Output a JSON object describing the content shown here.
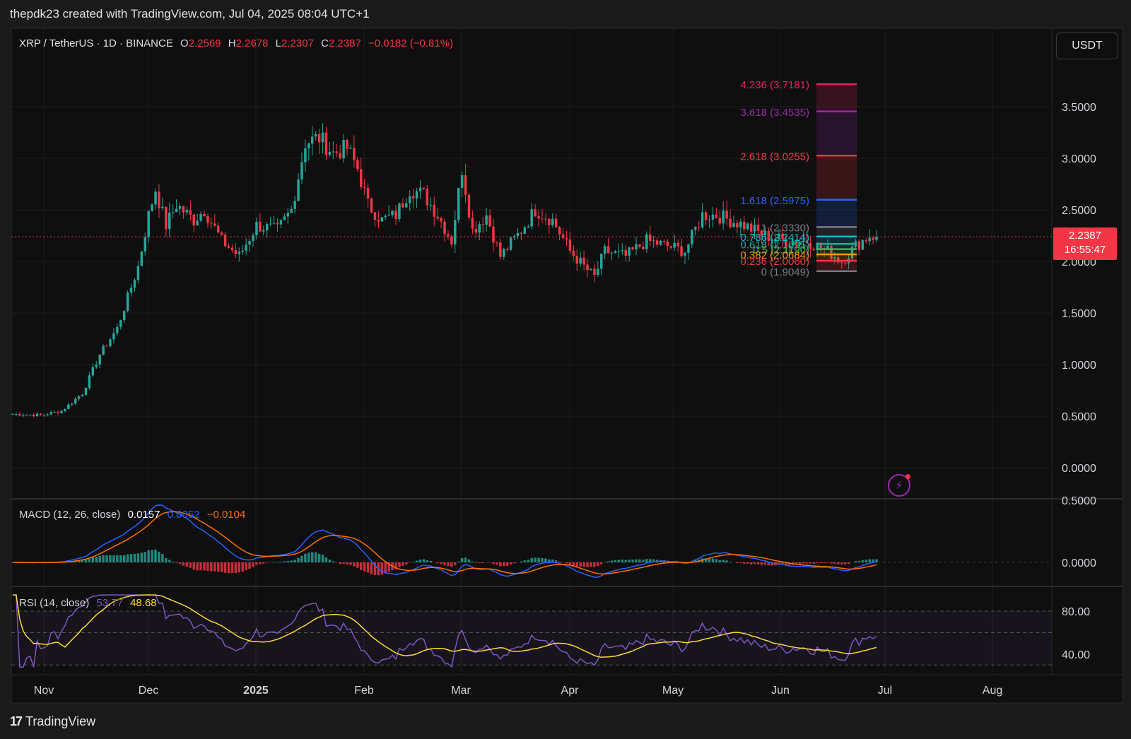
{
  "header": {
    "text": "thepdk23 created with TradingView.com, Jul 04, 2025 08:04 UTC+1"
  },
  "symbol": {
    "pair": "XRP / TetherUS · 1D · BINANCE",
    "o_label": "O",
    "o": "2.2569",
    "h_label": "H",
    "h": "2.2678",
    "l_label": "L",
    "l": "2.2307",
    "c_label": "C",
    "c": "2.2387",
    "change": "−0.0182 (−0.81%)"
  },
  "currency_button": "USDT",
  "last_price": {
    "value": "2.2387",
    "countdown": "16:55:47"
  },
  "colors": {
    "up": "#26a69a",
    "down": "#f23645",
    "bg": "#0f0f0f",
    "macd": "#2962ff",
    "signal": "#ff6d00",
    "rsi": "#7e57c2",
    "rsi_ma": "#fdd835"
  },
  "x_axis": {
    "labels": [
      "Nov",
      "Dec",
      "2025",
      "Feb",
      "Mar",
      "Apr",
      "May",
      "Jun",
      "Jul",
      "Aug"
    ]
  },
  "fib_levels": [
    {
      "label": "4.236 (3.7181)",
      "value": 3.7181,
      "color": "#e91e63"
    },
    {
      "label": "3.618 (3.4535)",
      "value": 3.4535,
      "color": "#9c27b0"
    },
    {
      "label": "2.618 (3.0255)",
      "value": 3.0255,
      "color": "#f23645"
    },
    {
      "label": "1.618 (2.5975)",
      "value": 2.5975,
      "color": "#2962ff"
    },
    {
      "label": "1 (2.3330)",
      "value": 2.333,
      "color": "#787b86"
    },
    {
      "label": "0.786 (2.2414)",
      "value": 2.2414,
      "color": "#00bcd4"
    },
    {
      "label": "0.618 (2.1695)",
      "value": 2.1695,
      "color": "#26a69a"
    },
    {
      "label": "0.5 (2.1190)",
      "value": 2.119,
      "color": "#4caf50"
    },
    {
      "label": "0.382 (2.0684)",
      "value": 2.0684,
      "color": "#ff9800"
    },
    {
      "label": "0.236 (2.0060)",
      "value": 2.006,
      "color": "#f23645"
    },
    {
      "label": "0 (1.9049)",
      "value": 1.9049,
      "color": "#787b86"
    }
  ],
  "macd": {
    "title": "MACD (12, 26, close)",
    "hist": "0.0157",
    "macd": "0.0052",
    "signal": "−0.0104",
    "axis_labels": [
      "0.5000",
      "0.0000"
    ]
  },
  "rsi": {
    "title": "RSI (14, close)",
    "value": "53.77",
    "ma": "48.68",
    "axis_labels": [
      "80.00",
      "40.00"
    ]
  },
  "brand": {
    "name": "TradingView"
  },
  "chart_data": {
    "type": "candlestick",
    "title": "XRP / TetherUS · 1D · BINANCE",
    "y_axis_labels": [
      "3.5000",
      "3.0000",
      "2.5000",
      "2.0000",
      "1.5000",
      "1.0000",
      "0.5000",
      "0.0000"
    ],
    "ylim": [
      -0.1,
      3.9
    ],
    "x_labels": [
      "Nov",
      "Dec",
      "2025",
      "Feb",
      "Mar",
      "Apr",
      "May",
      "Jun",
      "Jul",
      "Aug"
    ],
    "close_anchors": [
      {
        "day": 0,
        "v": 0.52
      },
      {
        "day": 8,
        "v": 0.51
      },
      {
        "day": 14,
        "v": 0.55
      },
      {
        "day": 20,
        "v": 0.72
      },
      {
        "day": 25,
        "v": 1.1
      },
      {
        "day": 30,
        "v": 1.35
      },
      {
        "day": 33,
        "v": 1.65
      },
      {
        "day": 36,
        "v": 1.95
      },
      {
        "day": 39,
        "v": 2.45
      },
      {
        "day": 41,
        "v": 2.7
      },
      {
        "day": 44,
        "v": 2.35
      },
      {
        "day": 47,
        "v": 2.55
      },
      {
        "day": 52,
        "v": 2.4
      },
      {
        "day": 55,
        "v": 2.5
      },
      {
        "day": 60,
        "v": 2.2
      },
      {
        "day": 65,
        "v": 2.05
      },
      {
        "day": 70,
        "v": 2.35
      },
      {
        "day": 76,
        "v": 2.3
      },
      {
        "day": 80,
        "v": 2.5
      },
      {
        "day": 84,
        "v": 3.15
      },
      {
        "day": 88,
        "v": 3.2
      },
      {
        "day": 92,
        "v": 3.05
      },
      {
        "day": 96,
        "v": 3.1
      },
      {
        "day": 99,
        "v": 2.9
      },
      {
        "day": 102,
        "v": 2.55
      },
      {
        "day": 106,
        "v": 2.4
      },
      {
        "day": 110,
        "v": 2.45
      },
      {
        "day": 114,
        "v": 2.7
      },
      {
        "day": 118,
        "v": 2.65
      },
      {
        "day": 122,
        "v": 2.45
      },
      {
        "day": 126,
        "v": 2.2
      },
      {
        "day": 129,
        "v": 2.9
      },
      {
        "day": 132,
        "v": 2.3
      },
      {
        "day": 136,
        "v": 2.45
      },
      {
        "day": 140,
        "v": 2.05
      },
      {
        "day": 146,
        "v": 2.3
      },
      {
        "day": 150,
        "v": 2.5
      },
      {
        "day": 155,
        "v": 2.4
      },
      {
        "day": 160,
        "v": 2.1
      },
      {
        "day": 164,
        "v": 1.95
      },
      {
        "day": 167,
        "v": 1.85
      },
      {
        "day": 170,
        "v": 2.1
      },
      {
        "day": 176,
        "v": 2.05
      },
      {
        "day": 182,
        "v": 2.2
      },
      {
        "day": 188,
        "v": 2.15
      },
      {
        "day": 193,
        "v": 2.1
      },
      {
        "day": 198,
        "v": 2.45
      },
      {
        "day": 202,
        "v": 2.45
      },
      {
        "day": 206,
        "v": 2.4
      },
      {
        "day": 210,
        "v": 2.35
      },
      {
        "day": 216,
        "v": 2.25
      },
      {
        "day": 222,
        "v": 2.2
      },
      {
        "day": 228,
        "v": 2.2
      },
      {
        "day": 234,
        "v": 2.1
      },
      {
        "day": 238,
        "v": 2.0
      },
      {
        "day": 242,
        "v": 2.15
      },
      {
        "day": 246,
        "v": 2.25
      },
      {
        "day": 248,
        "v": 2.2387
      }
    ]
  }
}
